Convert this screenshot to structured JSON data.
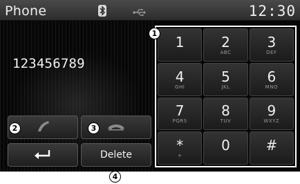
{
  "status_bar": {
    "title": "Phone",
    "time": "12:30",
    "bluetooth_icon": "bluetooth-icon",
    "usb_icon": "usb-icon"
  },
  "dial": {
    "number": "123456789"
  },
  "keypad": {
    "keys": [
      {
        "digit": "1",
        "letters": ""
      },
      {
        "digit": "2",
        "letters": "ABC"
      },
      {
        "digit": "3",
        "letters": "DEF"
      },
      {
        "digit": "4",
        "letters": "GHI"
      },
      {
        "digit": "5",
        "letters": "JKL"
      },
      {
        "digit": "6",
        "letters": "MNO"
      },
      {
        "digit": "7",
        "letters": "PQRS"
      },
      {
        "digit": "8",
        "letters": "TUV"
      },
      {
        "digit": "9",
        "letters": "WXYZ"
      },
      {
        "digit": "*",
        "letters": "+"
      },
      {
        "digit": "0",
        "letters": ""
      },
      {
        "digit": "#",
        "letters": ""
      }
    ]
  },
  "buttons": {
    "call_icon": "call-icon",
    "end_call_icon": "end-call-icon",
    "back_icon": "back-arrow-icon",
    "delete_label": "Delete"
  },
  "callouts": {
    "keypad": "1",
    "call": "2",
    "end_call": "3",
    "delete": "4"
  },
  "colors": {
    "background": "#060606",
    "status_bar": "#3a3a3a",
    "button": "#2a2a2a",
    "text": "#f0f0f0"
  }
}
